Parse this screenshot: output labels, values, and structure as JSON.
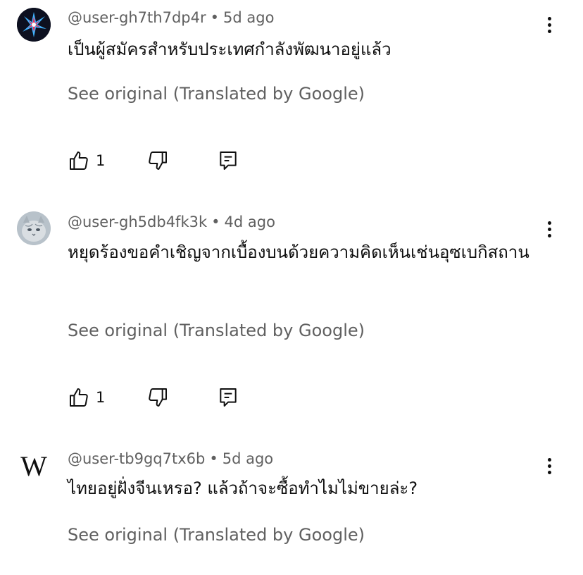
{
  "comments": [
    {
      "handle": "@user-gh7th7dp4r",
      "time": "5d ago",
      "text": "เป็นผู้สมัครสำหรับประเทศกำลังพัฒนาอยู่แล้ว",
      "see_original": "See original (Translated by Google)",
      "likes": "1",
      "avatar": "spark-avatar"
    },
    {
      "handle": "@user-gh5db4fk3k",
      "time": "4d ago",
      "text": "หยุดร้องขอคำเชิญจากเบื้องบนด้วยความคิดเห็นเช่นอุซเบกิสถาน",
      "see_original": "See original (Translated by Google)",
      "likes": "1",
      "avatar": "cat-avatar"
    },
    {
      "handle": "@user-tb9gq7tx6b",
      "time": "5d ago",
      "text": "ไทยอยู่ฝั่งจีนเหรอ? แล้วถ้าจะซื้อทำไมไม่ขายล่ะ?",
      "see_original": "See original (Translated by Google)",
      "avatar_letter": "W"
    }
  ],
  "separator": "•"
}
